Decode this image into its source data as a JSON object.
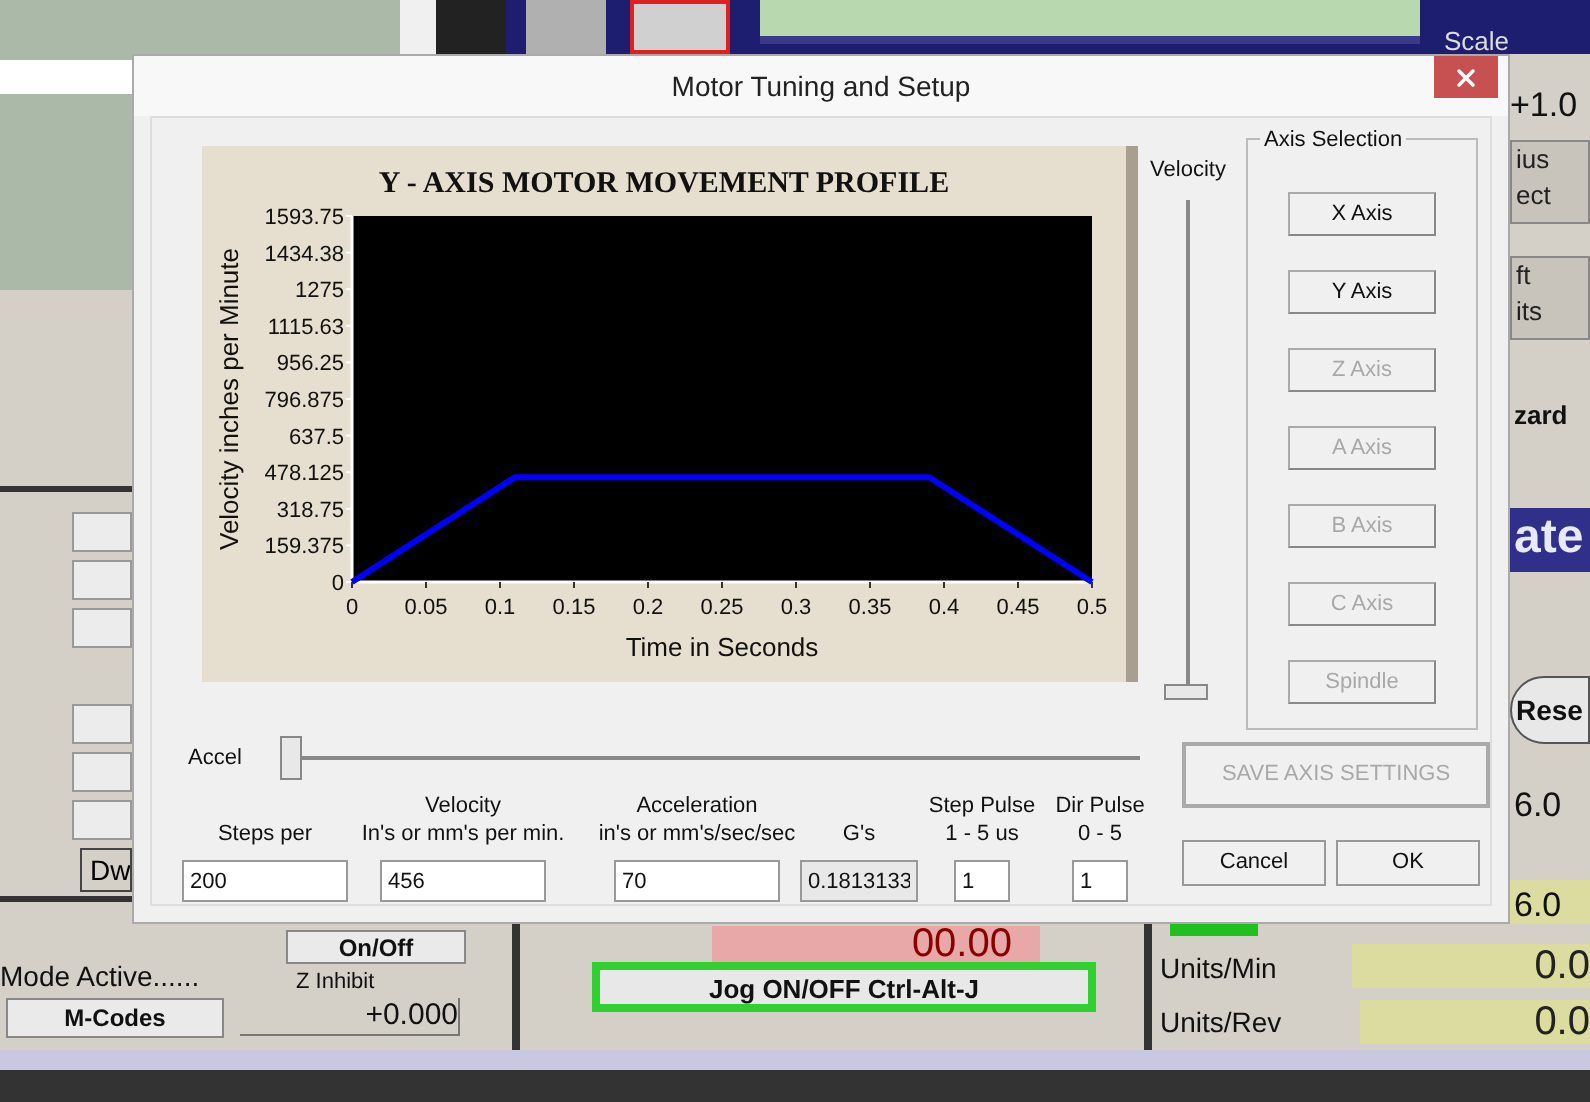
{
  "background_app": {
    "scale_label": "Scale",
    "scale_value": "+1.0",
    "fragments": [
      {
        "kind": "button",
        "lines": [
          "ius",
          "ect"
        ]
      },
      {
        "kind": "button",
        "lines": [
          "ft",
          "its"
        ]
      },
      {
        "kind": "label",
        "lines": [
          "zard"
        ]
      },
      {
        "kind": "banner",
        "lines": [
          "ate"
        ]
      },
      {
        "kind": "round",
        "lines": [
          "Rese"
        ]
      },
      {
        "kind": "value",
        "lines": [
          "6.0"
        ]
      },
      {
        "kind": "field",
        "lines": [
          "6.0"
        ]
      }
    ],
    "dwell_tab": "Dw",
    "mode_label": "Mode Active......",
    "mcodes_button": "M-Codes",
    "onoff_button": "On/Off",
    "z_inhibit_label": "Z Inhibit",
    "z_inhibit_value": "+0.000",
    "elapsed_value": "00.00",
    "jog_button": "Jog ON/OFF Ctrl-Alt-J",
    "units_min_label": "Units/Min",
    "units_min_value": "0.0",
    "units_rev_label": "Units/Rev",
    "units_rev_value": "0.0"
  },
  "dialog": {
    "title": "Motor Tuning and Setup",
    "chart_data": {
      "type": "line",
      "title": "Y - AXIS MOTOR MOVEMENT PROFILE",
      "xlabel": "Time in Seconds",
      "ylabel": "Velocity inches per Minute",
      "x": [
        0,
        0.11,
        0.39,
        0.5
      ],
      "series": [
        {
          "color": "#0000ff",
          "values": [
            0,
            456,
            456,
            0
          ]
        }
      ],
      "xlim": [
        0,
        0.5
      ],
      "ylim": [
        0,
        1593.75
      ],
      "xticks": [
        0,
        {
          "value": 0.05,
          "label": "0.05"
        },
        {
          "value": 0.1,
          "label": "0.1"
        },
        {
          "value": 0.15,
          "label": "0.15"
        },
        {
          "value": 0.2,
          "label": "0.2"
        },
        {
          "value": 0.25,
          "label": "0.25"
        },
        {
          "value": 0.3,
          "label": "0.3"
        },
        {
          "value": 0.35,
          "label": "0.35"
        },
        {
          "value": 0.4,
          "label": "0.4"
        },
        {
          "value": 0.45,
          "label": "0.45"
        },
        {
          "value": 0.5,
          "label": "0.5"
        }
      ],
      "yticks": [
        0,
        {
          "value": 159.375,
          "label": "159.375"
        },
        {
          "value": 318.75,
          "label": "318.75"
        },
        {
          "value": 478.125,
          "label": "478.125"
        },
        {
          "value": 637.5,
          "label": "637.5"
        },
        {
          "value": 796.875,
          "label": "796.875"
        },
        {
          "value": 956.25,
          "label": "956.25"
        },
        {
          "value": 1115.63,
          "label": "1115.63"
        },
        {
          "value": 1275,
          "label": "1275"
        },
        {
          "value": 1434.38,
          "label": "1434.38"
        },
        {
          "value": 1593.75,
          "label": "1593.75"
        }
      ]
    },
    "velocity_slider": {
      "label": "Velocity",
      "level": 0
    },
    "accel_slider": {
      "label": "Accel",
      "level": 0
    },
    "axis_selection": {
      "title": "Axis Selection",
      "buttons": [
        {
          "label": "X Axis",
          "disabled": false
        },
        {
          "label": "Y Axis",
          "disabled": false
        },
        {
          "label": "Z Axis",
          "disabled": true
        },
        {
          "label": "A Axis",
          "disabled": true
        },
        {
          "label": "B Axis",
          "disabled": true
        },
        {
          "label": "C Axis",
          "disabled": true
        },
        {
          "label": "Spindle",
          "disabled": true
        }
      ]
    },
    "fields": [
      {
        "label_lines": [
          "Steps per"
        ],
        "value": "200",
        "readonly": false
      },
      {
        "label_lines": [
          "Velocity",
          "In's or mm's per min."
        ],
        "value": "456",
        "readonly": false
      },
      {
        "label_lines": [
          "Acceleration",
          "in's or mm's/sec/sec"
        ],
        "value": "70",
        "readonly": false
      },
      {
        "label_lines": [
          "G's"
        ],
        "value": "0.1813133",
        "readonly": true
      },
      {
        "label_lines": [
          "Step Pulse",
          "1 - 5 us"
        ],
        "value": "1",
        "readonly": false
      },
      {
        "label_lines": [
          "Dir Pulse",
          "0 - 5"
        ],
        "value": "1",
        "readonly": false
      }
    ],
    "save_button": {
      "label": "SAVE AXIS SETTINGS",
      "disabled": true
    },
    "buttons": [
      "Cancel",
      "OK"
    ]
  }
}
